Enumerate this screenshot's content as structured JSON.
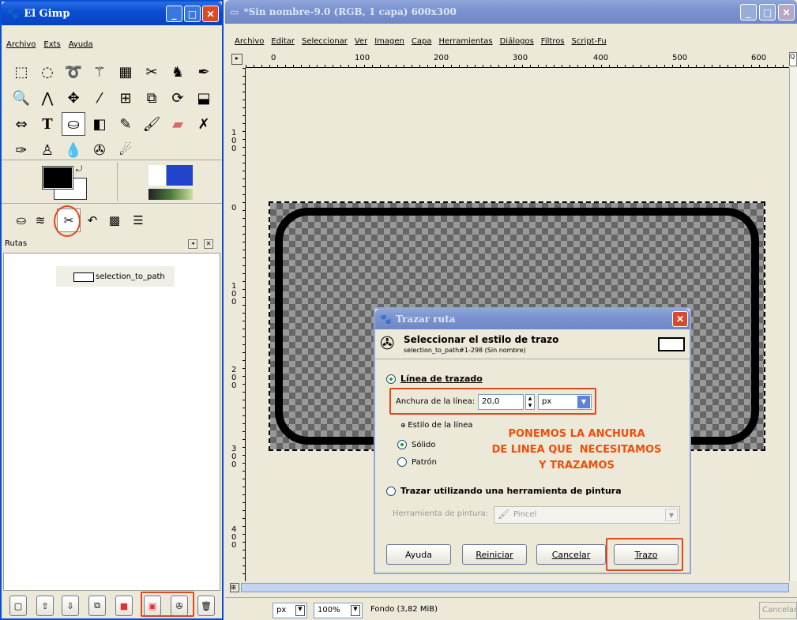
{
  "toolbox": {
    "title": "El Gimp",
    "menu": [
      "Archivo",
      "Exts",
      "Ayuda"
    ],
    "tools": [
      "rect-select-icon",
      "ellipse-select-icon",
      "lasso-icon",
      "fuzzy-select-icon",
      "color-select-icon",
      "scissors-icon",
      "foreground-select-icon",
      "paths-icon",
      "color-picker-icon",
      "zoom-icon",
      "measure-icon",
      "move-icon",
      "align-icon",
      "crop-icon",
      "rotate-icon",
      "scale-icon",
      "shear-icon",
      "perspective-icon",
      "flip-icon",
      "text-icon",
      "bucket-fill-icon",
      "blend-icon",
      "pencil-icon",
      "paintbrush-icon",
      "eraser-icon",
      "airbrush-icon",
      "ink-icon",
      "clone-icon",
      "heal-icon",
      "smudge-icon",
      "dodge-icon"
    ],
    "dock_tabs": [
      "tool-options-tab",
      "layers-tab",
      "paths-tab",
      "undo-tab",
      "colormap-tab",
      "channels-tab"
    ],
    "paths_title": "Rutas",
    "path_item": "selection_to_path"
  },
  "image_window": {
    "title": "*Sin nombre-9.0 (RGB, 1 capa) 600x300",
    "menu": [
      "Archivo",
      "Editar",
      "Seleccionar",
      "Ver",
      "Imagen",
      "Capa",
      "Herramientas",
      "Diálogos",
      "Filtros",
      "Script-Fu"
    ],
    "ruler_h": [
      "0",
      "100",
      "200",
      "300",
      "400",
      "500",
      "600"
    ],
    "ruler_v": [
      "0",
      "1\n0\n0",
      "2\n0\n0",
      "3\n0\n0",
      "4\n0\n0"
    ],
    "ruler_v_neg": "1\n0\n0",
    "status": {
      "unit": "px",
      "zoom": "100%",
      "layer": "Fondo (3,82 MiB)",
      "cancel": "Cancelar"
    }
  },
  "dialog": {
    "title": "Trazar ruta",
    "header": "Seleccionar el estilo de trazo",
    "subheader": "selection_to_path#1-298 (Sin nombre)",
    "option1": "Línea de trazado",
    "width_label": "Anchura de la línea:",
    "width_value": "20,0",
    "unit": "px",
    "line_style": "Estilo de la línea",
    "solid": "Sólido",
    "pattern": "Patrón",
    "option2": "Trazar utilizando una herramienta de pintura",
    "paint_tool_label": "Herramienta de pintura:",
    "paint_tool": "Pincel",
    "buttons": {
      "help": "Ayuda",
      "reset": "Reiniciar",
      "cancel": "Cancelar",
      "stroke": "Trazo"
    }
  },
  "annotation": [
    "PONEMOS LA ANCHURA",
    "DE LINEA QUE  NECESITAMOS",
    "Y TRAZAMOS"
  ],
  "colors": {
    "accent": "#e0481e",
    "titlebar": "#0a4fd3"
  }
}
